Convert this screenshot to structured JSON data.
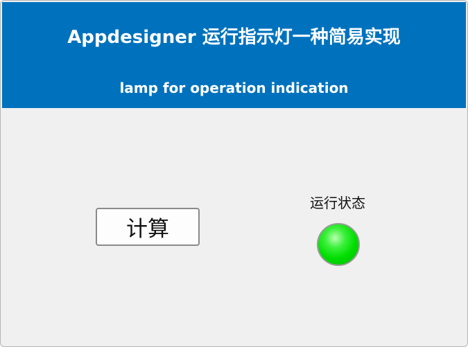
{
  "header": {
    "title": "Appdesigner 运行指示灯一种简易实现",
    "subtitle": "lamp for operation indication",
    "background_color": "#0072bd"
  },
  "controls": {
    "calculate_button_label": "计算",
    "lamp_label": "运行状态",
    "lamp_color": "#00e000"
  }
}
